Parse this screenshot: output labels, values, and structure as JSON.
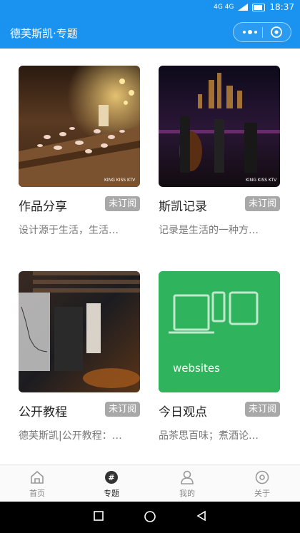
{
  "status_bar": {
    "network": "4G 4G",
    "time": "18:37"
  },
  "header": {
    "title": "德芙斯凯·专题"
  },
  "cards": [
    {
      "title": "作品分享",
      "badge": "未订阅",
      "desc": "设计源于生活，生活…",
      "image": "rose-petal-table-photo",
      "watermark": "KING KISS KTV"
    },
    {
      "title": "斯凯记录",
      "badge": "未订阅",
      "desc": "记录是生活的一种方…",
      "image": "night-band-photo",
      "watermark": "KING KISS KTV"
    },
    {
      "title": "公开教程",
      "badge": "未订阅",
      "desc": "德芙斯凯|公开教程：…",
      "image": "bar-equipment-photo"
    },
    {
      "title": "今日观点",
      "badge": "未订阅",
      "desc": "品茶思百味；煮酒论…",
      "image": "websites-devices-graphic",
      "image_text": "websites"
    }
  ],
  "tabs": [
    {
      "label": "首页",
      "icon": "home-icon",
      "active": false
    },
    {
      "label": "专题",
      "icon": "hashtag-icon",
      "active": true
    },
    {
      "label": "我的",
      "icon": "user-icon",
      "active": false
    },
    {
      "label": "关于",
      "icon": "about-icon",
      "active": false
    }
  ],
  "colors": {
    "primary": "#1a93f0",
    "badge": "#a8a8a8",
    "websites_green": "#2fb35d"
  }
}
